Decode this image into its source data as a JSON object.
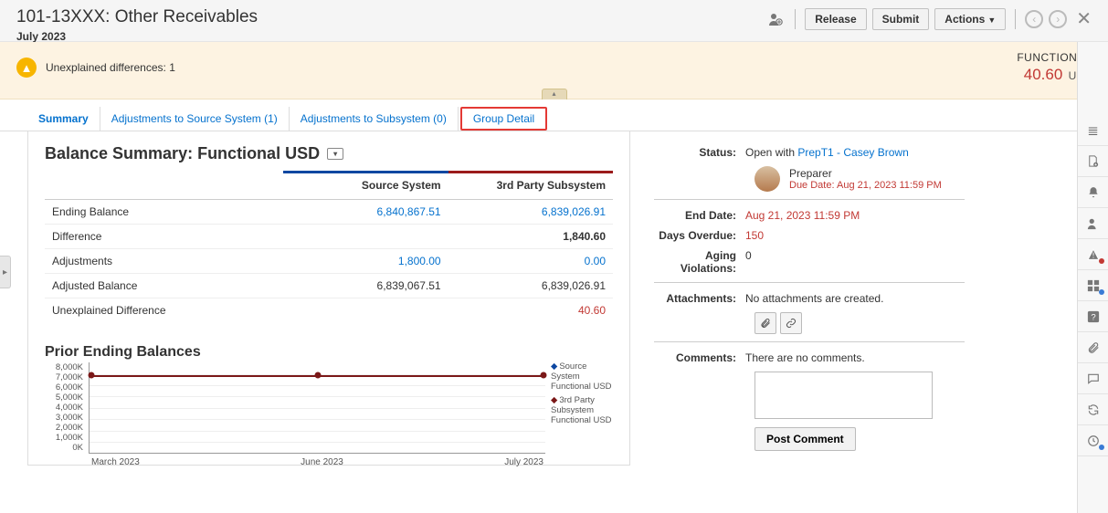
{
  "header": {
    "title": "101-13XXX: Other Receivables",
    "period": "July 2023",
    "buttons": {
      "release": "Release",
      "submit": "Submit",
      "actions": "Actions"
    }
  },
  "warning": {
    "text": "Unexplained differences: 1",
    "functional_label": "FUNCTIONAL",
    "functional_value": "40.60",
    "functional_currency": "USD"
  },
  "tabs": [
    {
      "label": "Summary",
      "active": true
    },
    {
      "label": "Adjustments to Source System (1)"
    },
    {
      "label": "Adjustments to Subsystem (0)"
    },
    {
      "label": "Group Detail",
      "highlighted": true
    }
  ],
  "balance_summary": {
    "title": "Balance Summary: Functional USD",
    "col_source": "Source System",
    "col_sub": "3rd Party Subsystem",
    "rows": {
      "ending_balance": {
        "label": "Ending Balance",
        "src": "6,840,867.51",
        "sub": "6,839,026.91",
        "link": true
      },
      "difference": {
        "label": "Difference",
        "src": "",
        "sub": "1,840.60"
      },
      "adjustments": {
        "label": "Adjustments",
        "src": "1,800.00",
        "sub": "0.00",
        "link": true
      },
      "adjusted": {
        "label": "Adjusted Balance",
        "src": "6,839,067.51",
        "sub": "6,839,026.91"
      },
      "unexplained": {
        "label": "Unexplained Difference",
        "src": "",
        "sub": "40.60",
        "neg": true
      }
    }
  },
  "prior": {
    "title": "Prior Ending Balances",
    "y_ticks": [
      "8,000K",
      "7,000K",
      "6,000K",
      "5,000K",
      "4,000K",
      "3,000K",
      "2,000K",
      "1,000K",
      "0K"
    ],
    "x_ticks": [
      "March 2023",
      "June 2023",
      "July 2023"
    ],
    "legend1": "Source System Functional USD",
    "legend2": "3rd Party Subsystem Functional USD"
  },
  "meta": {
    "status_label": "Status:",
    "status_prefix": "Open with ",
    "status_link": "PrepT1 - Casey Brown",
    "preparer_role": "Preparer",
    "due_prefix": "Due Date:  ",
    "due_value": "Aug 21, 2023 11:59 PM",
    "end_date_label": "End Date:",
    "end_date_value": "Aug 21, 2023 11:59 PM",
    "days_overdue_label": "Days Overdue:",
    "days_overdue_value": "150",
    "aging_label": "Aging Violations:",
    "aging_value": "0",
    "attach_label": "Attachments:",
    "attach_value": "No attachments are created.",
    "comments_label": "Comments:",
    "comments_value": "There are no comments.",
    "post_button": "Post Comment"
  },
  "chart_data": {
    "type": "line",
    "title": "Prior Ending Balances",
    "ylabel": "",
    "xlabel": "",
    "ylim": [
      0,
      8000
    ],
    "y_unit": "K",
    "categories": [
      "March 2023",
      "June 2023",
      "July 2023"
    ],
    "series": [
      {
        "name": "Source System Functional USD",
        "values": [
          6900,
          6900,
          6900
        ]
      },
      {
        "name": "3rd Party Subsystem Functional USD",
        "values": [
          6900,
          6900,
          6900
        ]
      }
    ]
  }
}
